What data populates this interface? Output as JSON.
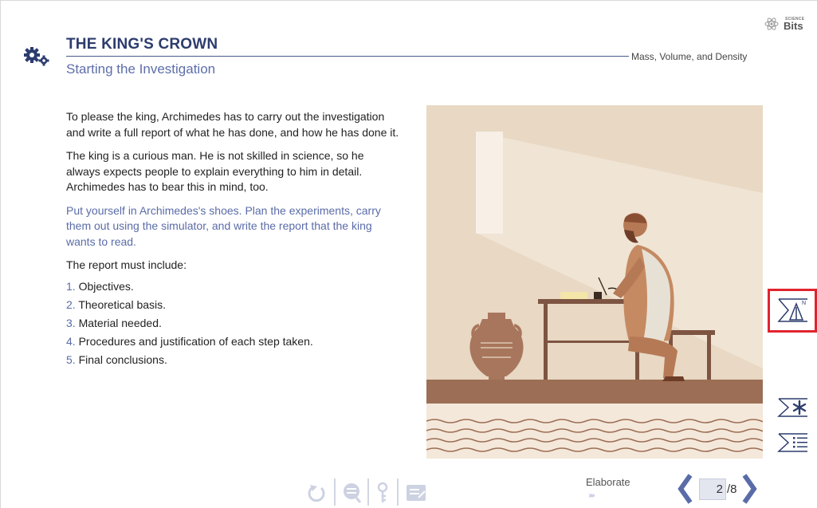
{
  "header": {
    "title": "THE KING'S CROWN",
    "subtitle": "Starting the Investigation",
    "topic": "Mass, Volume, and Density",
    "logo_small": "SCIENCE",
    "logo_big": "Bits"
  },
  "content": {
    "paragraphs": [
      "To please the king, Archimedes has to carry out the investigation and write a full report of what he has done, and how he has done it.",
      "The king is a curious man. He is not skilled in science, so he always expects people to explain everything to him in detail. Archimedes has to bear this in mind, too."
    ],
    "highlight": "Put yourself in Archimedes's shoes. Plan the experiments, carry them out using the simulator, and write the report that the king wants to read.",
    "list_intro": "The report must include:",
    "list_items": [
      {
        "num": "1.",
        "text": "Objectives."
      },
      {
        "num": "2.",
        "text": "Theoretical basis."
      },
      {
        "num": "3.",
        "text": "Material needed."
      },
      {
        "num": "4.",
        "text": "Procedures and justification of each step taken."
      },
      {
        "num": "5.",
        "text": "Final conclusions."
      }
    ]
  },
  "side_toolbar": {
    "compass_label": "N"
  },
  "footer": {
    "phase_label": "Elaborate",
    "phase_arrows": "›››››",
    "current_page": "2",
    "total_pages": "/8"
  },
  "colors": {
    "title": "#2d3c6e",
    "accent": "#5a6ca8",
    "highlight_border": "#e0242e",
    "illustration_bg": "#e8d8c4"
  }
}
